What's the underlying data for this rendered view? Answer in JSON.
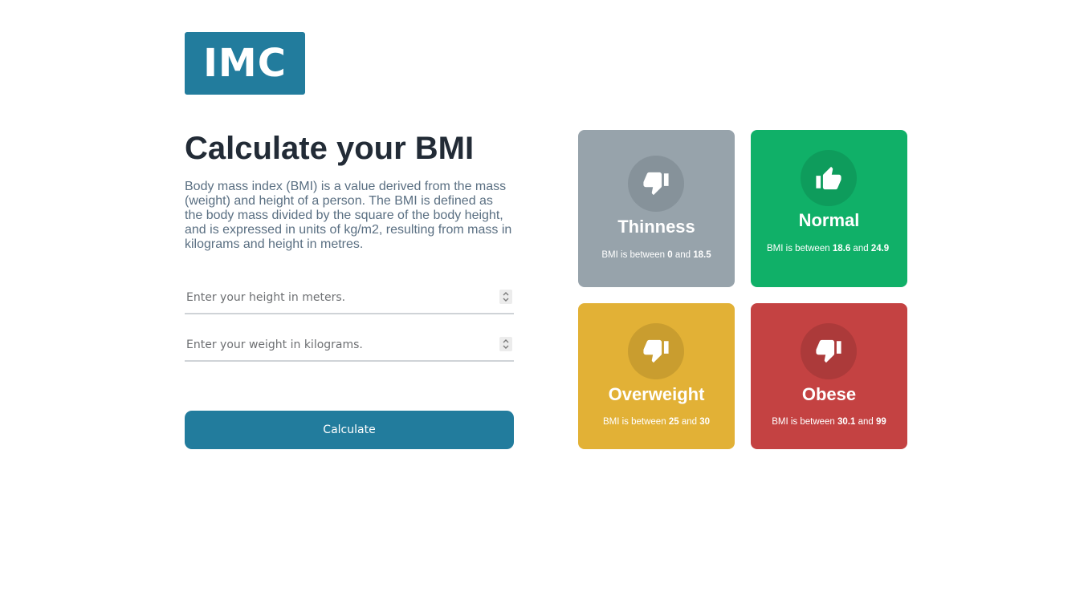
{
  "logo": {
    "text": "IMC"
  },
  "intro": {
    "title": "Calculate your BMI",
    "description": "Body mass index (BMI) is a value derived from the mass (weight) and height of a person. The BMI is defined as the body mass divided by the square of the body height, and is expressed in units of kg/m2, resulting from mass in kilograms and height in metres."
  },
  "form": {
    "height": {
      "placeholder": "Enter your height in meters.",
      "value": ""
    },
    "weight": {
      "placeholder": "Enter your weight in kilograms.",
      "value": ""
    },
    "calculate_label": "Calculate"
  },
  "categories": [
    {
      "title": "Thinness",
      "prefix": "BMI is between",
      "min": "0",
      "joiner": "and",
      "max": "18.5",
      "icon": "thumbs-down-icon",
      "color": "#97a3ab",
      "circle": "#86929a"
    },
    {
      "title": "Normal",
      "prefix": "BMI is between",
      "min": "18.6",
      "joiner": "and",
      "max": "24.9",
      "icon": "thumbs-up-icon",
      "color": "#10b068",
      "circle": "#0e9c5c"
    },
    {
      "title": "Overweight",
      "prefix": "BMI is between",
      "min": "25",
      "joiner": "and",
      "max": "30",
      "icon": "thumbs-down-icon",
      "color": "#e2b136",
      "circle": "#c99d2f"
    },
    {
      "title": "Obese",
      "prefix": "BMI is between",
      "min": "30.1",
      "joiner": "and",
      "max": "99",
      "icon": "thumbs-down-icon",
      "color": "#c44242",
      "circle": "#ac3a3a"
    }
  ]
}
